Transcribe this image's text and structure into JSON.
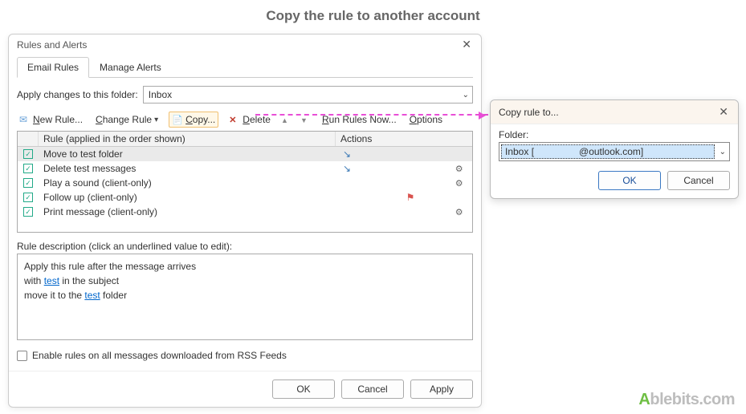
{
  "page_heading": "Copy the rule to another account",
  "dialog": {
    "title": "Rules and Alerts",
    "tabs": [
      "Email Rules",
      "Manage Alerts"
    ],
    "folder_label": "Apply changes to this folder:",
    "folder_value": "Inbox",
    "toolbar": {
      "new": "New Rule...",
      "change": "Change Rule",
      "copy": "Copy...",
      "delete": "Delete",
      "run": "Run Rules Now...",
      "options": "Options"
    },
    "columns": {
      "rule": "Rule (applied in the order shown)",
      "actions": "Actions"
    },
    "rules": [
      {
        "name": "Move to test folder",
        "icons": [
          "move"
        ],
        "selected": true
      },
      {
        "name": "Delete test messages",
        "icons": [
          "move",
          "tools"
        ],
        "selected": false
      },
      {
        "name": "Play a sound  (client-only)",
        "icons": [
          "tools"
        ],
        "selected": false
      },
      {
        "name": "Follow up  (client-only)",
        "icons": [
          "flag"
        ],
        "selected": false
      },
      {
        "name": "Print message  (client-only)",
        "icons": [
          "tools"
        ],
        "selected": false
      }
    ],
    "desc_label": "Rule description (click an underlined value to edit):",
    "desc": {
      "line1": "Apply this rule after the message arrives",
      "line2a": "with ",
      "line2link": "test",
      "line2b": " in the subject",
      "line3a": "move it to the ",
      "line3link": "test",
      "line3b": " folder"
    },
    "rss_label": "Enable rules on all messages downloaded from RSS Feeds",
    "buttons": {
      "ok": "OK",
      "cancel": "Cancel",
      "apply": "Apply"
    }
  },
  "copy_dialog": {
    "title": "Copy rule to...",
    "folder_label": "Folder:",
    "folder_value_prefix": "Inbox [",
    "folder_value_suffix": "@outlook.com]",
    "ok": "OK",
    "cancel": "Cancel"
  },
  "watermark": {
    "brand_a": "A",
    "brand_rest": "blebits",
    "tld": ".com"
  }
}
